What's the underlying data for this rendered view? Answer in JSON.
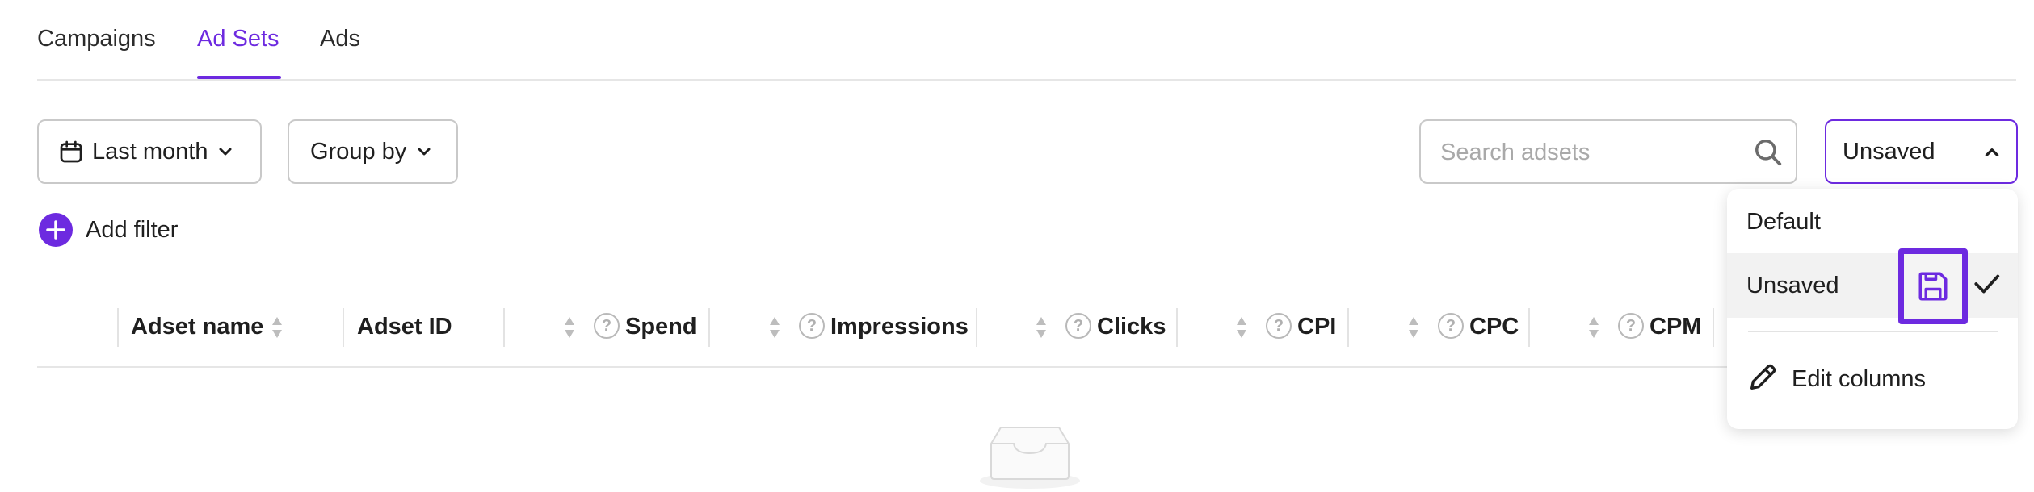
{
  "tabs": [
    {
      "label": "Campaigns"
    },
    {
      "label": "Ad Sets",
      "active": true
    },
    {
      "label": "Ads"
    }
  ],
  "toolbar": {
    "date_range": "Last month",
    "group_by": "Group by",
    "search_placeholder": "Search adsets",
    "view_selected": "Unsaved",
    "add_filter": "Add filter"
  },
  "table": {
    "columns": [
      {
        "label": "Adset name"
      },
      {
        "label": "Adset ID"
      },
      {
        "label": "Spend"
      },
      {
        "label": "Impressions"
      },
      {
        "label": "Clicks"
      },
      {
        "label": "CPI"
      },
      {
        "label": "CPC"
      },
      {
        "label": "CPM"
      }
    ]
  },
  "views_menu": {
    "items": [
      {
        "label": "Default"
      },
      {
        "label": "Unsaved",
        "selected": true
      }
    ],
    "edit_columns": "Edit columns"
  },
  "colors": {
    "accent": "#6d2ae0",
    "border": "#c9c9c9",
    "muted": "#a9a9a9"
  }
}
